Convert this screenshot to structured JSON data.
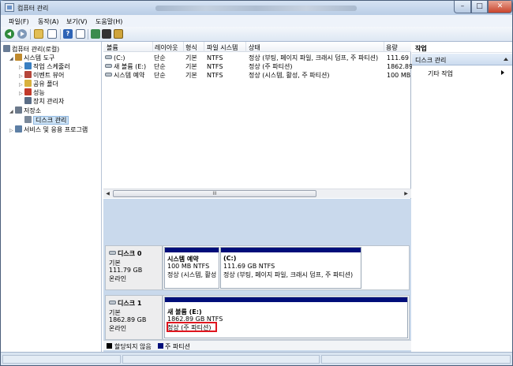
{
  "window": {
    "title": "컴퓨터 관리",
    "min_glyph": "–",
    "max_glyph": "□",
    "close_glyph": "✕"
  },
  "menu": [
    "파일(F)",
    "동작(A)",
    "보기(V)",
    "도움말(H)"
  ],
  "toolbar": {
    "help_glyph": "?"
  },
  "tree": {
    "root": "컴퓨터 관리(로컬)",
    "items": [
      {
        "label": "시스템 도구",
        "icon": "tools-icon",
        "color": "#c08a2d"
      },
      {
        "label": "작업 스케줄러",
        "icon": "clock-icon",
        "color": "#3a7fc1"
      },
      {
        "label": "이벤트 뷰어",
        "icon": "event-viewer-icon",
        "color": "#b5463a"
      },
      {
        "label": "공유 폴더",
        "icon": "shared-folder-icon",
        "color": "#d9b13e"
      },
      {
        "label": "성능",
        "icon": "performance-icon",
        "color": "#c23a2b"
      },
      {
        "label": "장치 관리자",
        "icon": "device-manager-icon",
        "color": "#5a6d86"
      },
      {
        "label": "저장소",
        "icon": "storage-icon",
        "color": "#6c7a8c"
      },
      {
        "label": "디스크 관리",
        "icon": "disk-management-icon",
        "color": "#7a8899"
      },
      {
        "label": "서비스 및 응용 프로그램",
        "icon": "services-icon",
        "color": "#5d7fa5"
      }
    ]
  },
  "volume_table": {
    "headers": [
      "볼륨",
      "레이아웃",
      "형식",
      "파일 시스템",
      "상태",
      "용량"
    ],
    "rows": [
      {
        "volume": "(C:)",
        "layout": "단순",
        "type": "기본",
        "fs": "NTFS",
        "status": "정상 (부팅, 페이지 파일, 크래시 덤프, 주 파티션)",
        "capacity": "111.69"
      },
      {
        "volume": "새 볼륨 (E:)",
        "layout": "단순",
        "type": "기본",
        "fs": "NTFS",
        "status": "정상 (주 파티션)",
        "capacity": "1862.89"
      },
      {
        "volume": "시스템 예약",
        "layout": "단순",
        "type": "기본",
        "fs": "NTFS",
        "status": "정상 (시스템, 활성, 주 파티션)",
        "capacity": "100 MB"
      }
    ]
  },
  "scrollbar": {
    "grip": "III",
    "left_glyph": "◀",
    "right_glyph": "▶"
  },
  "disks": [
    {
      "name": "디스크 0",
      "type": "기본",
      "size": "111.79 GB",
      "status": "온라인",
      "partitions": [
        {
          "name": "시스템 예약",
          "size_fs": "100 MB NTFS",
          "status": "정상 (시스템, 활성"
        },
        {
          "name": "(C:)",
          "size_fs": "111.69 GB NTFS",
          "status": "정상 (부팅, 페이지 파일, 크래시 덤프, 주 파티션)"
        }
      ]
    },
    {
      "name": "디스크 1",
      "type": "기본",
      "size": "1862.89 GB",
      "status": "온라인",
      "partitions": [
        {
          "name": "새 볼륨 (E:)",
          "size_fs": "1862.89 GB NTFS",
          "status": "정상 (주 파티션)"
        }
      ]
    }
  ],
  "legend": {
    "unallocated": {
      "label": "할당되지 않음",
      "color": "#000000"
    },
    "primary": {
      "label": "주 파티션",
      "color": "#000e7a"
    }
  },
  "actions": {
    "title": "작업",
    "section": "디스크 관리",
    "item": "기타 작업"
  },
  "colors": {
    "highlight": "#e0161f",
    "primary_partition": "#000e7a",
    "selection": "#cde3f7"
  }
}
